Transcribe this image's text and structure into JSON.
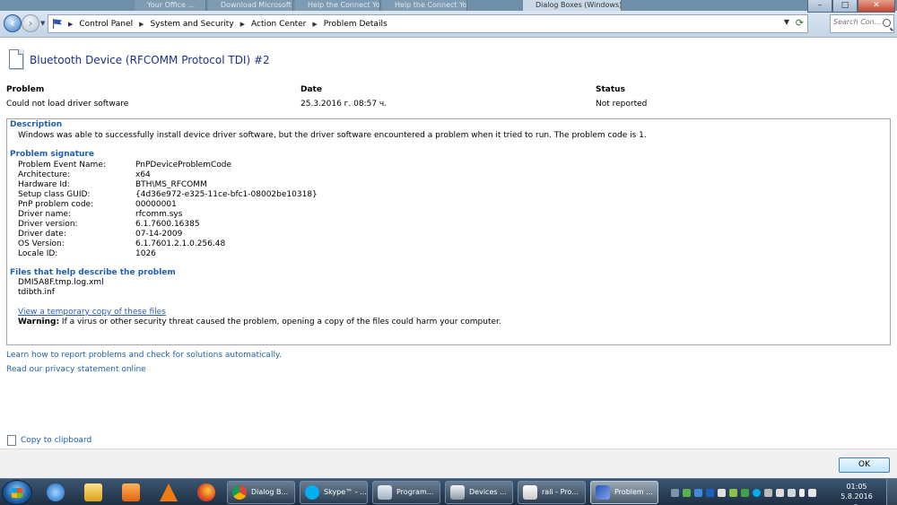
{
  "browser_tabs": [
    {
      "label": ""
    },
    {
      "label": "Your Office ..."
    },
    {
      "label": "Download Microsoft ..."
    },
    {
      "label": "Help the Connect Your C..."
    },
    {
      "label": "Dialog Boxes (Windows)"
    }
  ],
  "window_controls": {
    "minimize": "–",
    "maximize": "□",
    "close": "✕"
  },
  "addressbar": {
    "crumbs": [
      "Control Panel",
      "System and Security",
      "Action Center",
      "Problem Details"
    ],
    "search_placeholder": "Search Con..."
  },
  "page": {
    "title": "Bluetooth Device (RFCOMM Protocol TDI) #2",
    "problem_header": "Problem",
    "problem_value": "Could not load driver software",
    "date_header": "Date",
    "date_value": "25.3.2016 г. 08:57 ч.",
    "status_header": "Status",
    "status_value": "Not reported"
  },
  "details": {
    "description_title": "Description",
    "description_text": "Windows was able to successfully install device driver software, but the driver software encountered a problem when it tried to run. The problem code is 1.",
    "signature_title": "Problem signature",
    "signature": [
      {
        "label": "Problem Event Name:",
        "value": "PnPDeviceProblemCode"
      },
      {
        "label": "Architecture:",
        "value": "x64"
      },
      {
        "label": "Hardware Id:",
        "value": "BTH\\MS_RFCOMM"
      },
      {
        "label": "Setup class GUID:",
        "value": "{4d36e972-e325-11ce-bfc1-08002be10318}"
      },
      {
        "label": "PnP problem code:",
        "value": "00000001"
      },
      {
        "label": "Driver name:",
        "value": "rfcomm.sys"
      },
      {
        "label": "Driver version:",
        "value": "6.1.7600.16385"
      },
      {
        "label": "Driver date:",
        "value": "07-14-2009"
      },
      {
        "label": "OS Version:",
        "value": "6.1.7601.2.1.0.256.48"
      },
      {
        "label": "Locale ID:",
        "value": "1026"
      }
    ],
    "files_title": "Files that help describe the problem",
    "files": [
      "DMI5A8F.tmp.log.xml",
      "tdibth.inf"
    ],
    "view_copy_link": "View a temporary copy of these files",
    "warning_label": "Warning:",
    "warning_text": " If a virus or other security threat caused the problem, opening a copy of the files could harm your computer."
  },
  "links": {
    "learn": "Learn how to report problems and check for solutions automatically.",
    "privacy": "Read our privacy statement online",
    "copy": "Copy to clipboard"
  },
  "buttons": {
    "ok": "OK"
  },
  "taskbar": {
    "pinned": [
      "internet-explorer-icon",
      "folder-icon",
      "media-player-icon",
      "vlc-icon",
      "firefox-icon"
    ],
    "tasks": [
      {
        "label": "Dialog B...",
        "icon": "chrome-icon"
      },
      {
        "label": "Skype™ - ...",
        "icon": "skype-icon"
      },
      {
        "label": "Program...",
        "icon": "program-icon"
      },
      {
        "label": "Devices ...",
        "icon": "devices-icon"
      },
      {
        "label": "rali - Pro...",
        "icon": "folder-icon"
      },
      {
        "label": "Problem ...",
        "icon": "action-center-icon"
      }
    ],
    "clock_time": "01:05",
    "clock_date": "5.8.2016 г."
  },
  "colors": {
    "accent_link": "#1f5fb5",
    "title": "#1e3287",
    "taskbar": "#1d2f44"
  }
}
